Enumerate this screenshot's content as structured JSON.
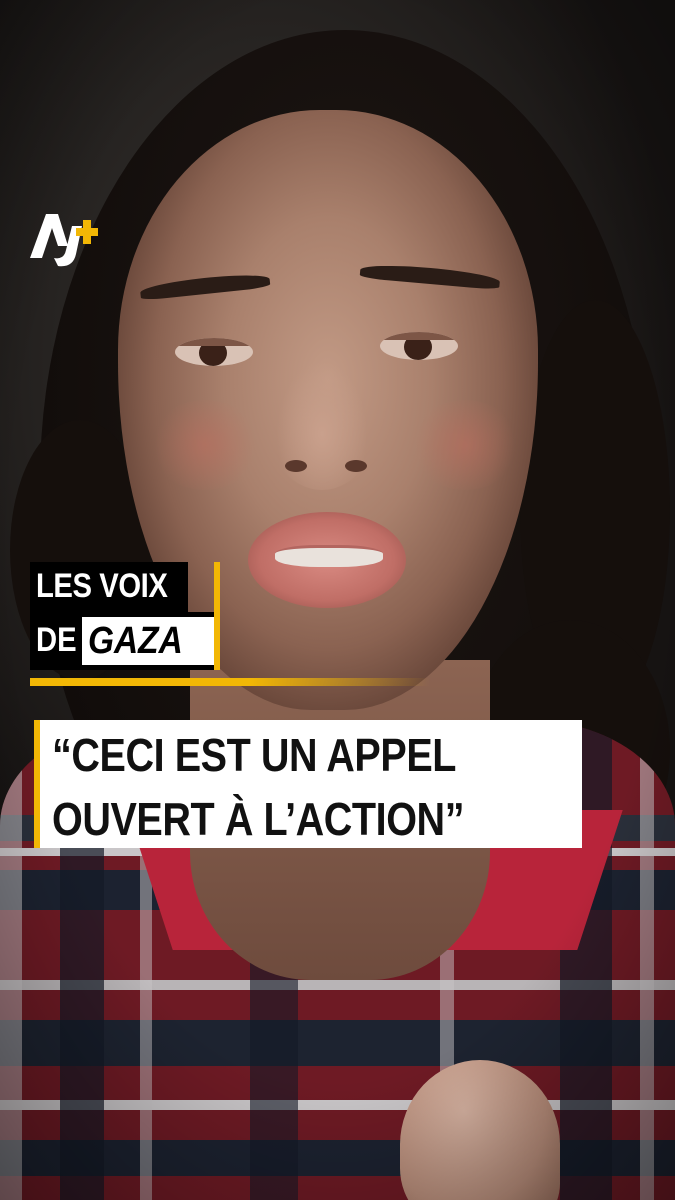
{
  "brand": {
    "logo_text": "AJ+",
    "logo_color": "#f2b705"
  },
  "series": {
    "line1": "LES VOIX",
    "line2_prefix": "DE",
    "line2_highlight": "GAZA",
    "accent_color": "#f2b705"
  },
  "quote": {
    "line1": "“CECI EST UN APPEL",
    "line2": "OUVERT À L’ACTION”"
  }
}
